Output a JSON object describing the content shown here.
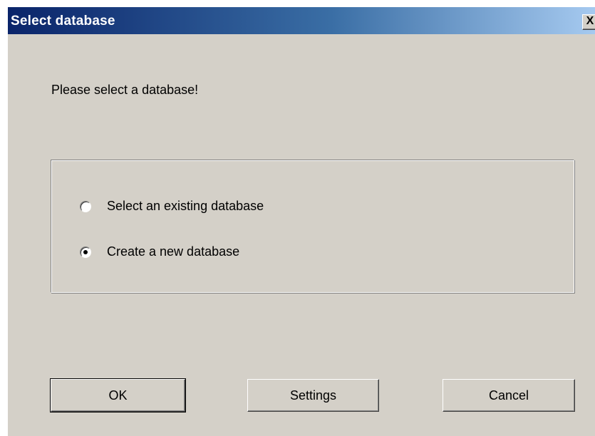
{
  "window": {
    "title": "Select database",
    "close_label": "X"
  },
  "prompt": "Please select a database!",
  "options": {
    "existing_label": "Select an existing database",
    "existing_selected": false,
    "new_label": "Create a new database",
    "new_selected": true
  },
  "buttons": {
    "ok_label": "OK",
    "settings_label": "Settings",
    "cancel_label": "Cancel"
  },
  "colors": {
    "title_gradient_start": "#0a246a",
    "title_gradient_end": "#a6caf0",
    "dialog_face": "#d4d0c8"
  }
}
